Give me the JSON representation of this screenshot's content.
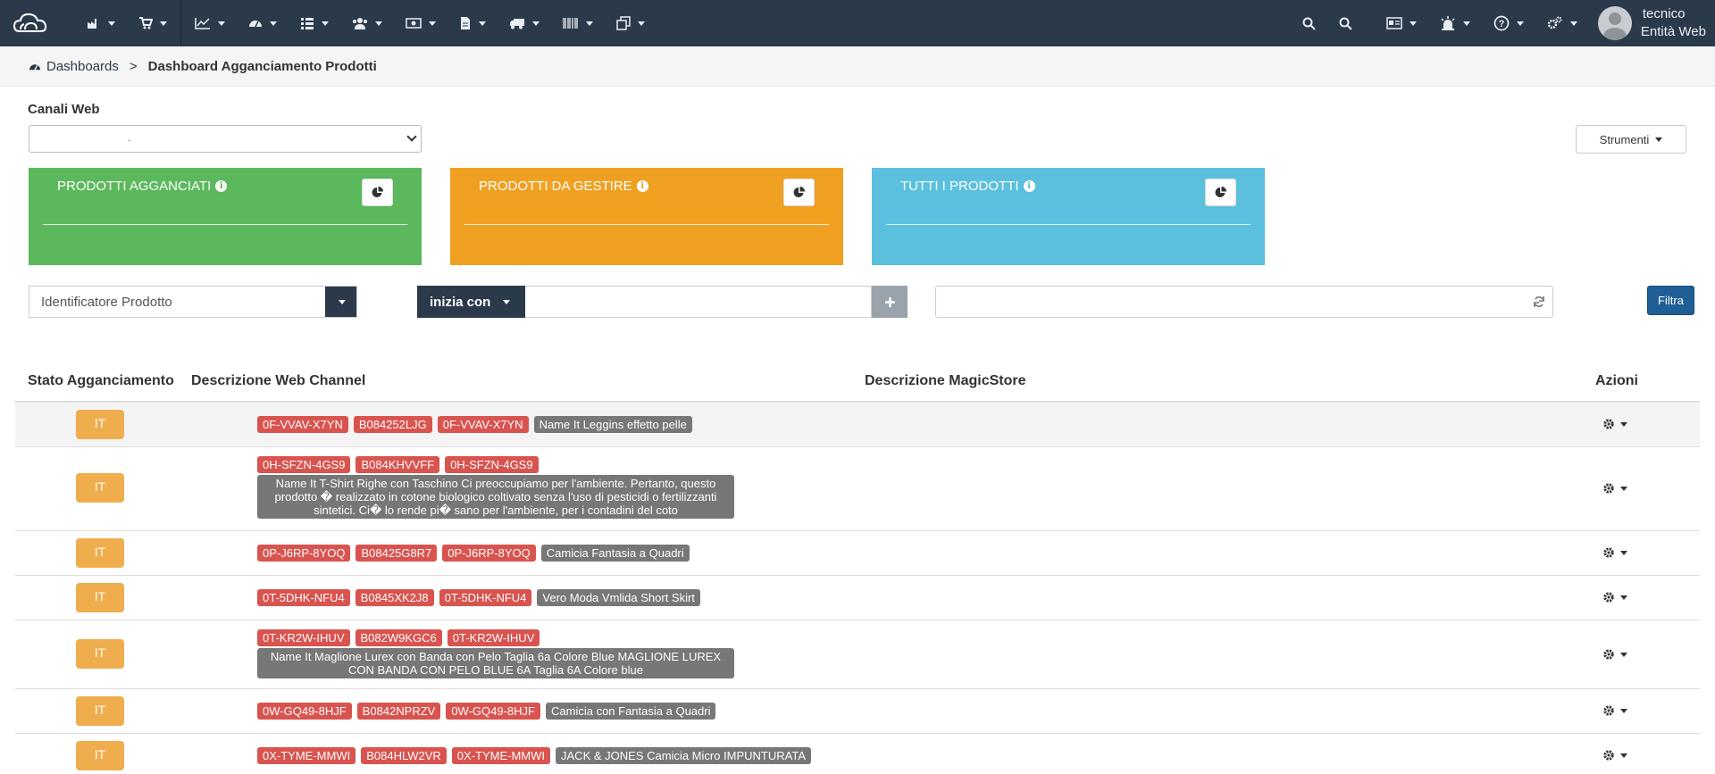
{
  "nav": {
    "items": [
      {
        "icon": "factory-icon"
      },
      {
        "icon": "cart-icon"
      },
      {
        "icon": "chart-line-icon"
      },
      {
        "icon": "dashboard-icon"
      },
      {
        "icon": "list-icon"
      },
      {
        "icon": "users-icon"
      },
      {
        "icon": "money-icon"
      },
      {
        "icon": "file-icon"
      },
      {
        "icon": "truck-icon"
      },
      {
        "icon": "barcode-icon"
      },
      {
        "icon": "clone-icon"
      }
    ],
    "user_name": "tecnico",
    "user_entity": "Entità Web"
  },
  "breadcrumb": {
    "home": "Dashboards",
    "separator": ">",
    "current": "Dashboard Agganciamento Prodotti"
  },
  "canali": {
    "label": "Canali Web",
    "selected": "."
  },
  "strumenti_label": "Strumenti",
  "tiles": [
    {
      "title": "PRODOTTI AGGANCIATI",
      "color": "#5cb85c"
    },
    {
      "title": "PRODOTTI DA GESTIRE",
      "color": "#f0a020"
    },
    {
      "title": "TUTTI I PRODOTTI",
      "color": "#5bc0de"
    }
  ],
  "filters": {
    "field": "Identificatore Prodotto",
    "operator": "inizia con",
    "filter_button": "Filtra"
  },
  "table": {
    "headers": [
      "Stato Agganciamento",
      "Descrizione Web Channel",
      "Descrizione MagicStore",
      "Azioni"
    ],
    "rows": [
      {
        "state": "IT",
        "codes": [
          "0F-VVAV-X7YN",
          "B084252LJG",
          "0F-VVAV-X7YN"
        ],
        "description": "Name It Leggins effetto pelle"
      },
      {
        "state": "IT",
        "codes": [
          "0H-SFZN-4GS9",
          "B084KHVVFF",
          "0H-SFZN-4GS9"
        ],
        "description": "Name It T-Shirt Righe con Taschino Ci preoccupiamo per l'ambiente. Pertanto, questo prodotto � realizzato in cotone biologico coltivato senza l'uso di pesticidi o fertilizzanti sintetici. Ci� lo rende pi� sano per l'ambiente, per i contadini del coto"
      },
      {
        "state": "IT",
        "codes": [
          "0P-J6RP-8YOQ",
          "B08425G8R7",
          "0P-J6RP-8YOQ"
        ],
        "description": "Camicia Fantasia a Quadri"
      },
      {
        "state": "IT",
        "codes": [
          "0T-5DHK-NFU4",
          "B0845XK2J8",
          "0T-5DHK-NFU4"
        ],
        "description": "Vero Moda Vmlida Short Skirt"
      },
      {
        "state": "IT",
        "codes": [
          "0T-KR2W-IHUV",
          "B082W9KGC6",
          "0T-KR2W-IHUV"
        ],
        "description": "Name It Maglione Lurex con Banda con Pelo Taglia 6a Colore Blue MAGLIONE LUREX CON BANDA CON PELO BLUE 6A Taglia 6A Colore blue"
      },
      {
        "state": "IT",
        "codes": [
          "0W-GQ49-8HJF",
          "B0842NPRZV",
          "0W-GQ49-8HJF"
        ],
        "description": "Camicia con Fantasia a Quadri"
      },
      {
        "state": "IT",
        "codes": [
          "0X-TYME-MMWI",
          "B084HLW2VR",
          "0X-TYME-MMWI"
        ],
        "description": "JACK & JONES Camicia Micro IMPUNTURATA"
      }
    ]
  },
  "colors": {
    "topbar": "#2b3a4a",
    "state_badge": "#f0ad4e",
    "code_label": "#d9534f",
    "desc_label": "#777777",
    "filtra": "#1f5f96"
  }
}
